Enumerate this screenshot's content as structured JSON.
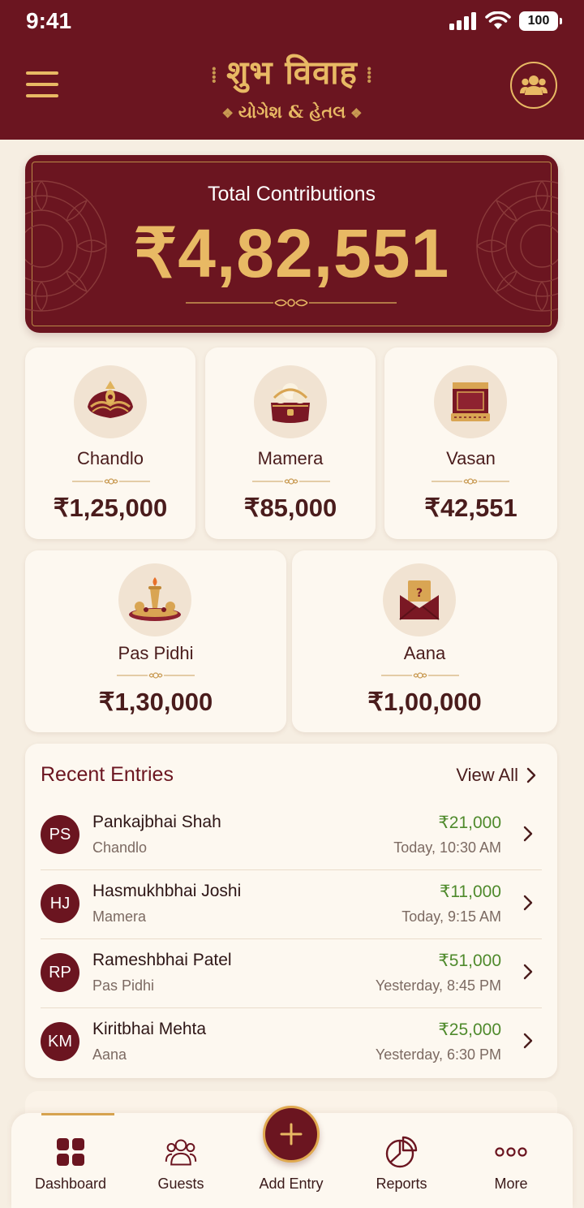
{
  "status": {
    "time": "9:41",
    "battery": "100"
  },
  "header": {
    "title": "शुभ विवाह",
    "subtitle": "યોગેશ & હેતલ",
    "title_ornament": "⁞",
    "subtitle_ornament": "❖"
  },
  "total": {
    "label": "Total Contributions",
    "value": "₹4,82,551"
  },
  "categories": [
    {
      "label": "Chandlo",
      "amount": "₹1,25,000",
      "icon": "turban-icon"
    },
    {
      "label": "Mamera",
      "amount": "₹85,000",
      "icon": "gift-basket-icon"
    },
    {
      "label": "Vasan",
      "amount": "₹42,551",
      "icon": "saree-icon"
    },
    {
      "label": "Pas Pidhi",
      "amount": "₹1,30,000",
      "icon": "puja-thali-icon"
    },
    {
      "label": "Aana",
      "amount": "₹1,00,000",
      "icon": "envelope-icon"
    }
  ],
  "recent": {
    "title": "Recent Entries",
    "view_all": "View All",
    "entries": [
      {
        "initials": "PS",
        "name": "Pankajbhai Shah",
        "category": "Chandlo",
        "amount": "₹21,000",
        "time": "Today, 10:30 AM"
      },
      {
        "initials": "HJ",
        "name": "Hasmukhbhai Joshi",
        "category": "Mamera",
        "amount": "₹11,000",
        "time": "Today, 9:15 AM"
      },
      {
        "initials": "RP",
        "name": "Rameshbhai Patel",
        "category": "Pas Pidhi",
        "amount": "₹51,000",
        "time": "Yesterday, 8:45 PM"
      },
      {
        "initials": "KM",
        "name": "Kiritbhai Mehta",
        "category": "Aana",
        "amount": "₹25,000",
        "time": "Yesterday, 6:30 PM"
      }
    ]
  },
  "nav": {
    "dashboard": "Dashboard",
    "guests": "Guests",
    "add_entry": "Add Entry",
    "reports": "Reports",
    "more": "More",
    "active": "dashboard"
  },
  "colors": {
    "maroon": "#6b1520",
    "gold": "#e8b964",
    "cream": "#f6eee2",
    "card": "#fdf8f0",
    "amount_green": "#4f8a2c"
  }
}
